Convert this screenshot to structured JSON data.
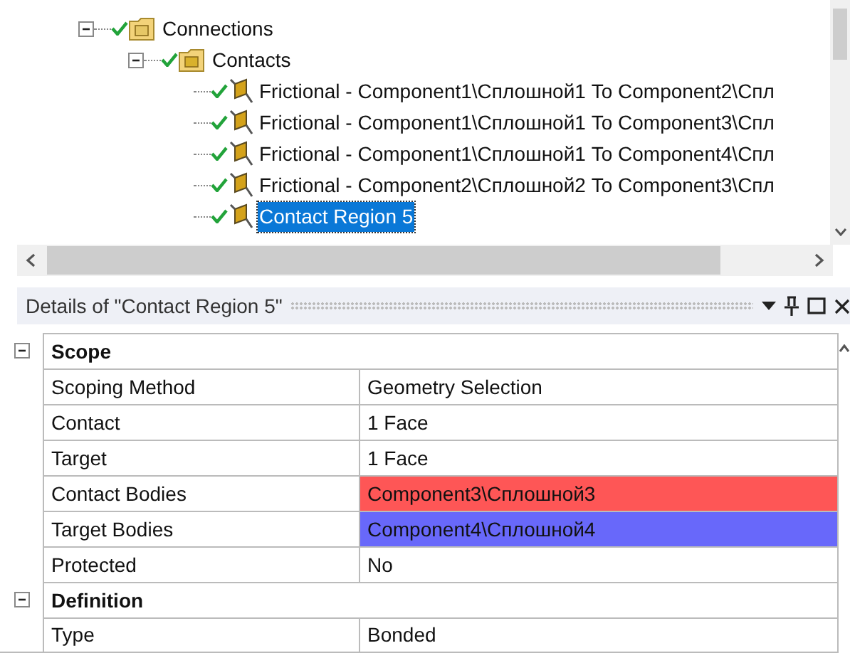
{
  "tree": [
    {
      "label": "Connections",
      "checked": true,
      "expanded": true,
      "children": [
        {
          "label": "Contacts",
          "checked": true,
          "expanded": true,
          "children": [
            {
              "label": "Frictional - Component1\\Сплошной1 To Component2\\Спл",
              "checked": true,
              "selected": false
            },
            {
              "label": "Frictional - Component1\\Сплошной1 To Component3\\Спл",
              "checked": true,
              "selected": false
            },
            {
              "label": "Frictional - Component1\\Сплошной1 To Component4\\Спл",
              "checked": true,
              "selected": false
            },
            {
              "label": "Frictional - Component2\\Сплошной2 To Component3\\Спл",
              "checked": true,
              "selected": false
            },
            {
              "label": "Contact Region 5",
              "checked": true,
              "selected": true
            }
          ]
        }
      ]
    }
  ],
  "details": {
    "title": "Details of \"Contact Region 5\"",
    "rows": [
      {
        "kind": "section",
        "label": "Scope",
        "expanded": true
      },
      {
        "kind": "row",
        "label": "Scoping Method",
        "value": "Geometry Selection"
      },
      {
        "kind": "row",
        "label": "Contact",
        "value": "1 Face"
      },
      {
        "kind": "row",
        "label": "Target",
        "value": "1 Face"
      },
      {
        "kind": "row",
        "label": "Contact Bodies",
        "value": "Component3\\Сплошной3",
        "color": "#fe5656"
      },
      {
        "kind": "row",
        "label": "Target Bodies",
        "value": "Component4\\Сплошной4",
        "color": "#6868fa"
      },
      {
        "kind": "row",
        "label": "Protected",
        "value": "No"
      },
      {
        "kind": "section",
        "label": "Definition",
        "expanded": true
      },
      {
        "kind": "row",
        "label": "Type",
        "value": "Bonded"
      }
    ]
  }
}
